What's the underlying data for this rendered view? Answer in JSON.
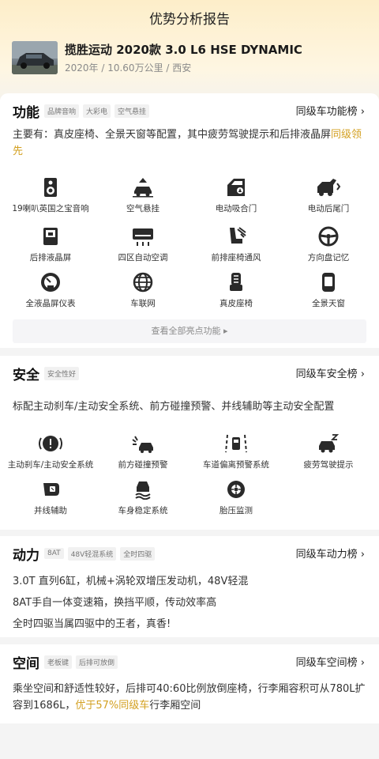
{
  "page_title": "优势分析报告",
  "car": {
    "title": "揽胜运动 2020款 3.0 L6 HSE DYNAMIC",
    "meta": "2020年 / 10.60万公里 / 西安"
  },
  "function_section": {
    "title": "功能",
    "tags": [
      "品牌音响",
      "大彩电",
      "空气悬挂"
    ],
    "rank_link": "同级车功能榜 ›",
    "desc_prefix": "主要有：真皮座椅、全景天窗等配置，其中疲劳驾驶提示和后排液晶屏",
    "desc_highlight": "同级领先",
    "features": [
      {
        "label": "19喇叭英国之宝音响",
        "icon": "speaker-icon"
      },
      {
        "label": "空气悬挂",
        "icon": "air-suspension-icon"
      },
      {
        "label": "电动吸合门",
        "icon": "door-icon"
      },
      {
        "label": "电动后尾门",
        "icon": "tailgate-icon"
      },
      {
        "label": "后排液晶屏",
        "icon": "rear-screen-icon"
      },
      {
        "label": "四区自动空调",
        "icon": "air-conditioner-icon"
      },
      {
        "label": "前排座椅通风",
        "icon": "seat-ventilation-icon"
      },
      {
        "label": "方向盘记忆",
        "icon": "steering-wheel-icon"
      },
      {
        "label": "全液晶屏仪表",
        "icon": "lcd-gauge-icon"
      },
      {
        "label": "车联网",
        "icon": "globe-icon"
      },
      {
        "label": "真皮座椅",
        "icon": "leather-seat-icon"
      },
      {
        "label": "全景天窗",
        "icon": "sunroof-icon"
      }
    ],
    "view_all": "查看全部亮点功能 ▸"
  },
  "safety_section": {
    "title": "安全",
    "tags": [
      "安全性好"
    ],
    "rank_link": "同级车安全榜 ›",
    "desc": "标配主动刹车/主动安全系统、前方碰撞预警、并线辅助等主动安全配置",
    "features": [
      {
        "label": "主动刹车/主动安全系统",
        "icon": "brake-icon"
      },
      {
        "label": "前方碰撞预警",
        "icon": "collision-warning-icon"
      },
      {
        "label": "车道偏离预警系统",
        "icon": "lane-departure-icon"
      },
      {
        "label": "疲劳驾驶提示",
        "icon": "fatigue-icon"
      },
      {
        "label": "并线辅助",
        "icon": "mirror-icon"
      },
      {
        "label": "车身稳定系统",
        "icon": "stability-icon"
      },
      {
        "label": "胎压监测",
        "icon": "tire-icon"
      }
    ]
  },
  "power_section": {
    "title": "动力",
    "tags": [
      "8AT",
      "48V轻混系统",
      "全时四驱"
    ],
    "rank_link": "同级车动力榜 ›",
    "lines": [
      "3.0T 直列6缸，机械+涡轮双增压发动机，48V轻混",
      "8AT手自一体变速箱，换挡平顺，传动效率高",
      "全时四驱当属四驱中的王者，真香!"
    ]
  },
  "space_section": {
    "title": "空间",
    "tags": [
      "老板键",
      "后排可放倒"
    ],
    "rank_link": "同级车空间榜 ›",
    "desc_prefix": "乘坐空间和舒适性较好，后排可40:60比例放倒座椅，行李厢容积可从780L扩容到1686L，",
    "desc_highlight": "优于57%同级车",
    "desc_suffix": "行李厢空间"
  },
  "colors": {
    "highlight": "#d3a021",
    "header_bg": "#fdeec9"
  }
}
